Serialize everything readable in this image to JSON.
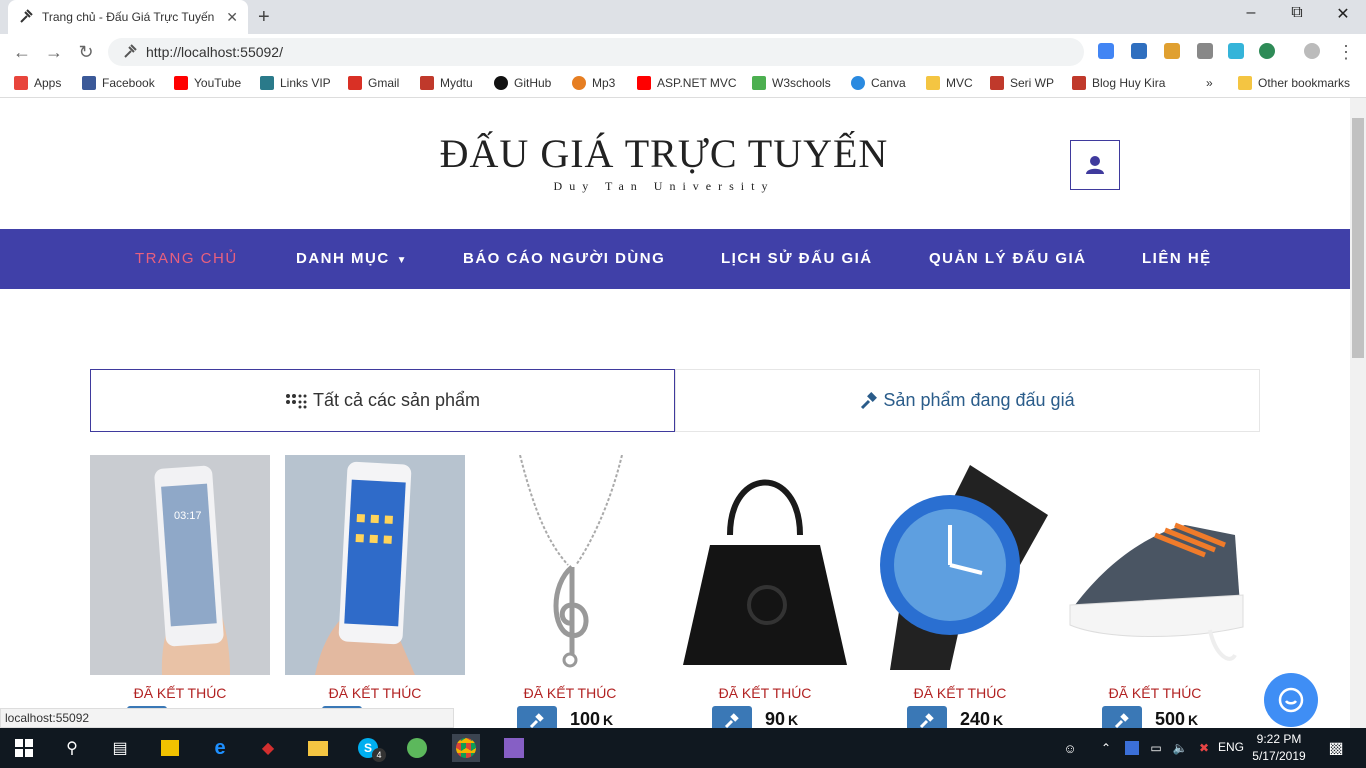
{
  "browser": {
    "tab_title": "Trang chủ - Đấu Giá Trực Tuyến",
    "tab_close": "✕",
    "new_tab": "+",
    "url": "http://localhost:55092/",
    "status_url": "localhost:55092"
  },
  "bookmarks": [
    {
      "label": "Apps",
      "icon": "apps-grid-icon",
      "color": "#e8453c"
    },
    {
      "label": "Facebook",
      "icon": "facebook-icon",
      "color": "#3b5998"
    },
    {
      "label": "YouTube",
      "icon": "youtube-icon",
      "color": "#ff0000"
    },
    {
      "label": "Links VIP",
      "icon": "cloud-icon",
      "color": "#2a7a8a"
    },
    {
      "label": "Gmail",
      "icon": "gmail-icon",
      "color": "#d93025"
    },
    {
      "label": "Mydtu",
      "icon": "mydtu-icon",
      "color": "#c0392b"
    },
    {
      "label": "GitHub",
      "icon": "github-icon",
      "color": "#111111"
    },
    {
      "label": "Mp3",
      "icon": "mp3-icon",
      "color": "#e67e22"
    },
    {
      "label": "ASP.NET MVC",
      "icon": "youtube-icon",
      "color": "#ff0000"
    },
    {
      "label": "W3schools",
      "icon": "w3schools-icon",
      "color": "#4caf50"
    },
    {
      "label": "Canva",
      "icon": "canva-icon",
      "color": "#2a8ae0"
    },
    {
      "label": "MVC",
      "icon": "folder-icon",
      "color": "#f4c542"
    },
    {
      "label": "Seri WP",
      "icon": "k-icon",
      "color": "#c0392b"
    },
    {
      "label": "Blog Huy Kira",
      "icon": "k-icon",
      "color": "#c0392b"
    }
  ],
  "bookmarks_more": "»",
  "other_bookmarks": "Other bookmarks",
  "site": {
    "title": "ĐẤU GIÁ TRỰC TUYẾN",
    "subtitle": "Duy Tan University"
  },
  "nav": [
    {
      "label": "TRANG CHỦ",
      "active": true
    },
    {
      "label": "DANH MỤC",
      "dropdown": true
    },
    {
      "label": "BÁO CÁO NGƯỜI DÙNG"
    },
    {
      "label": "LỊCH SỬ ĐẤU GIÁ"
    },
    {
      "label": "QUẢN LÝ ĐẤU GIÁ"
    },
    {
      "label": "LIÊN HỆ"
    }
  ],
  "tabs": {
    "all": "Tất cả các sản phẩm",
    "live": "Sản phẩm đang đấu giá"
  },
  "products": [
    {
      "status": "ĐÃ KẾT THÚC",
      "price": "",
      "unit": "",
      "image": "phone-icon"
    },
    {
      "status": "ĐÃ KẾT THÚC",
      "price": "",
      "unit": "",
      "image": "phone-icon"
    },
    {
      "status": "ĐÃ KẾT THÚC",
      "price": "100",
      "unit": "K",
      "image": "necklace-icon"
    },
    {
      "status": "ĐÃ KẾT THÚC",
      "price": "90",
      "unit": "K",
      "image": "handbag-icon"
    },
    {
      "status": "ĐÃ KẾT THÚC",
      "price": "240",
      "unit": "K",
      "image": "watch-icon"
    },
    {
      "status": "ĐÃ KẾT THÚC",
      "price": "500",
      "unit": "K",
      "image": "sneaker-icon"
    }
  ],
  "taskbar": {
    "lang": "ENG",
    "time": "9:22 PM",
    "date": "5/17/2019",
    "skype_badge": "4"
  },
  "colors": {
    "nav_bg": "#4040a8",
    "active_nav": "#e8607e",
    "status_red": "#b22222",
    "bid_button": "#3a78b6",
    "chat_bubble": "#3f8ef5"
  }
}
